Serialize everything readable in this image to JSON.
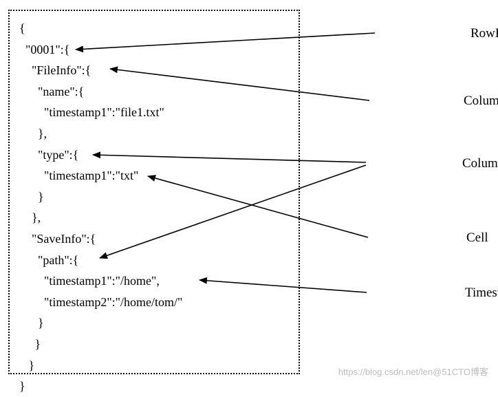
{
  "json": {
    "l0": "{",
    "l1": "  \"0001\":{",
    "l2": "    \"FileInfo\":{",
    "l3": "      \"name\":{",
    "l4": "        \"timestamp1\":\"file1.txt\"",
    "l5": "      },",
    "l6": "      \"type\":{",
    "l7": "        \"timestamp1\":\"txt\"",
    "l8": "      }",
    "l9": "    },",
    "l10": "    \"SaveInfo\":{",
    "l11": "      \"path\":{",
    "l12": "        \"timestamp1\":\"/home\",",
    "l13": "        \"timestamp2\":\"/home/tom/\"",
    "l14": "      }",
    "l15": "     }",
    "l16": "   }",
    "l17": "}"
  },
  "labels": {
    "rowkey": "RowKey",
    "colfam": "Column Family",
    "colqual": "Column Qualifier",
    "cell": "Cell",
    "timestamp": "Timestamp"
  },
  "watermark": "https://blog.csdn.net/len@51CTO博客"
}
